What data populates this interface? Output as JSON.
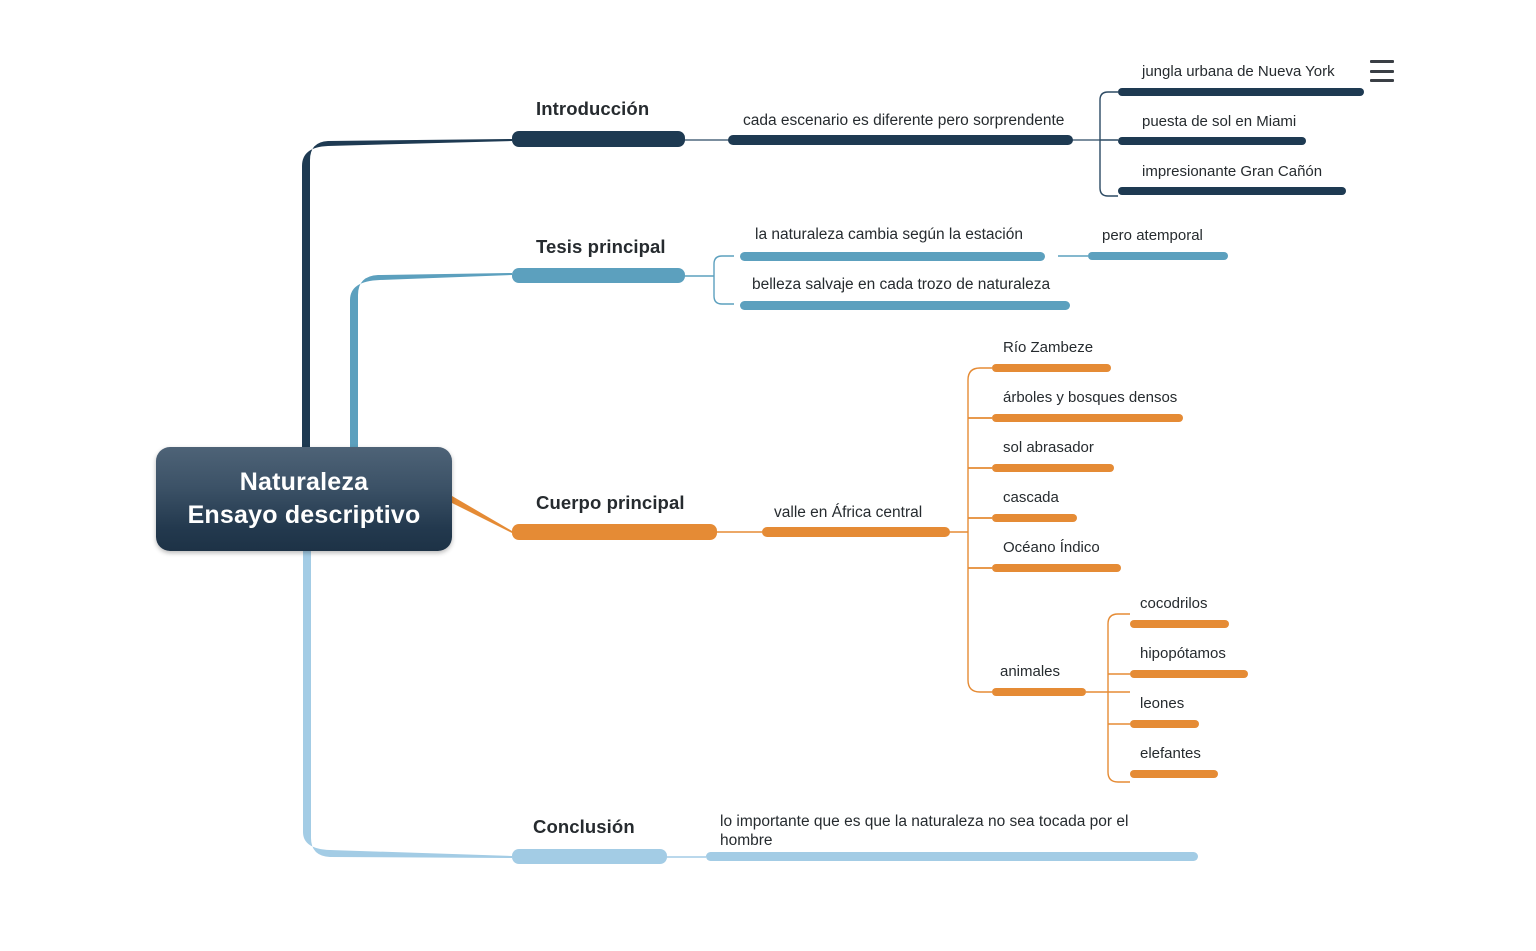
{
  "colors": {
    "root_dark": "#1d3246",
    "intro": "#1e3a52",
    "tesis": "#5ca0be",
    "cuerpo": "#e58b35",
    "conclusion": "#a3cce5",
    "text": "#262b2f",
    "background": "#ffffff"
  },
  "root": {
    "line1": "Naturaleza",
    "line2": "Ensayo descriptivo"
  },
  "menu": {
    "icon": "hamburger-menu-icon",
    "label": "Menú"
  },
  "branches": [
    {
      "id": "introduccion",
      "label": "Introducción",
      "color": "#1e3a52",
      "children": [
        {
          "label": "cada escenario es diferente pero sorprendente",
          "children": [
            {
              "label": "jungla urbana de Nueva York"
            },
            {
              "label": "puesta de sol en Miami"
            },
            {
              "label": "impresionante Gran Cañón"
            }
          ]
        }
      ]
    },
    {
      "id": "tesis-principal",
      "label": "Tesis principal",
      "color": "#5ca0be",
      "children": [
        {
          "label": "la naturaleza cambia según la estación",
          "children": [
            {
              "label": "pero atemporal"
            }
          ]
        },
        {
          "label": "belleza salvaje en cada trozo de naturaleza",
          "children": []
        }
      ]
    },
    {
      "id": "cuerpo-principal",
      "label": "Cuerpo principal",
      "color": "#e58b35",
      "children": [
        {
          "label": "valle en África central",
          "children": [
            {
              "label": "Río Zambeze"
            },
            {
              "label": "árboles y bosques densos"
            },
            {
              "label": "sol abrasador"
            },
            {
              "label": "cascada"
            },
            {
              "label": "Océano Índico"
            },
            {
              "label": "animales",
              "children": [
                {
                  "label": "cocodrilos"
                },
                {
                  "label": "hipopótamos"
                },
                {
                  "label": "leones"
                },
                {
                  "label": "elefantes"
                }
              ]
            }
          ]
        }
      ]
    },
    {
      "id": "conclusion",
      "label": "Conclusión",
      "color": "#a3cce5",
      "children": [
        {
          "label": "lo importante que es que la naturaleza no sea tocada por el hombre",
          "children": []
        }
      ]
    }
  ],
  "labels": {
    "intro_main": "Introducción",
    "intro_c1": "cada escenario es diferente pero sorprendente",
    "intro_l1": "jungla urbana de Nueva York",
    "intro_l2": "puesta de sol en Miami",
    "intro_l3": "impresionante Gran Cañón",
    "tesis_main": "Tesis principal",
    "tesis_c1": "la naturaleza cambia según la estación",
    "tesis_c1_l1": "pero atemporal",
    "tesis_c2": "belleza salvaje en cada trozo de naturaleza",
    "cuerpo_main": "Cuerpo principal",
    "cuerpo_c1": "valle en África central",
    "cuerpo_l1": "Río Zambeze",
    "cuerpo_l2": "árboles y bosques densos",
    "cuerpo_l3": "sol abrasador",
    "cuerpo_l4": "cascada",
    "cuerpo_l5": "Océano Índico",
    "cuerpo_l6": "animales",
    "animal_1": "cocodrilos",
    "animal_2": "hipopótamos",
    "animal_3": "leones",
    "animal_4": "elefantes",
    "concl_main": "Conclusión",
    "concl_c1": "lo importante que es que la naturaleza no sea tocada por el hombre"
  }
}
